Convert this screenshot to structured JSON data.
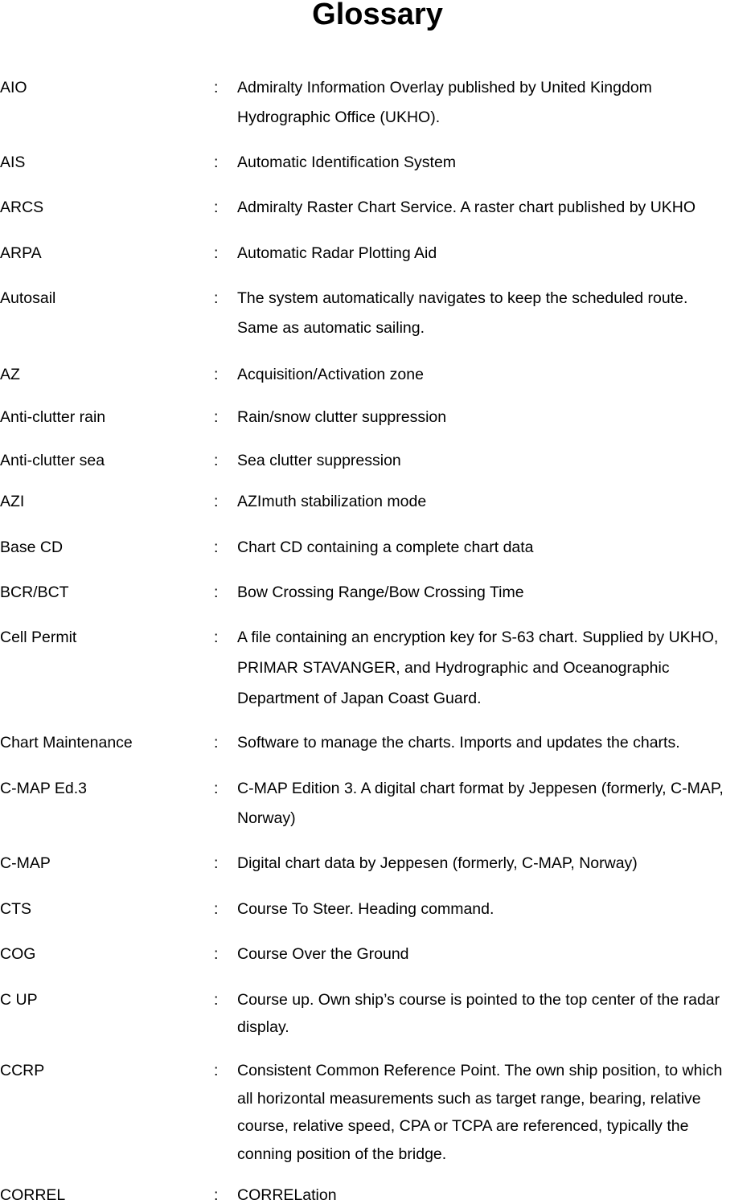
{
  "title": "Glossary",
  "separator": ":",
  "entries": [
    {
      "term": "AIO",
      "lines": [
        "Admiralty Information Overlay published by United Kingdom",
        "Hydrographic Office (UKHO)."
      ]
    },
    {
      "term": "AIS",
      "lines": [
        "Automatic Identification System"
      ]
    },
    {
      "term": "ARCS",
      "lines": [
        "Admiralty Raster Chart Service. A raster chart published by UKHO"
      ]
    },
    {
      "term": "ARPA",
      "lines": [
        "Automatic Radar Plotting Aid"
      ]
    },
    {
      "term": "Autosail",
      "lines": [
        "The system automatically navigates to keep the scheduled route.",
        "Same as automatic sailing."
      ]
    },
    {
      "term": "AZ",
      "lines": [
        "Acquisition/Activation zone"
      ]
    },
    {
      "term": "Anti-clutter rain",
      "lines": [
        "Rain/snow clutter suppression"
      ]
    },
    {
      "term": "Anti-clutter sea",
      "lines": [
        "Sea clutter suppression"
      ]
    },
    {
      "term": "AZI",
      "lines": [
        "AZImuth stabilization mode"
      ]
    },
    {
      "term": "Base CD",
      "lines": [
        "Chart CD containing a complete chart data"
      ]
    },
    {
      "term": "BCR/BCT",
      "lines": [
        "Bow Crossing Range/Bow Crossing Time"
      ]
    },
    {
      "term": "Cell Permit",
      "lines": [
        "A file containing an encryption key for S-63 chart. Supplied by UKHO,",
        "PRIMAR STAVANGER, and Hydrographic and Oceanographic",
        "Department of Japan Coast Guard."
      ]
    },
    {
      "term": "Chart Maintenance",
      "lines": [
        "Software to manage the charts. Imports and updates the charts."
      ]
    },
    {
      "term": "C-MAP Ed.3",
      "lines": [
        "C-MAP Edition 3. A digital chart format by Jeppesen (formerly, C-MAP,",
        "Norway)"
      ]
    },
    {
      "term": "C-MAP",
      "lines": [
        "Digital chart data by Jeppesen (formerly, C-MAP, Norway)"
      ]
    },
    {
      "term": "CTS",
      "lines": [
        "Course To Steer. Heading command."
      ]
    },
    {
      "term": "COG",
      "lines": [
        "Course Over the Ground"
      ]
    },
    {
      "term": "C UP",
      "lines": [
        "Course up. Own ship’s course is pointed to the top center of the radar",
        "display."
      ]
    },
    {
      "term": "CCRP",
      "lines": [
        "Consistent Common Reference Point. The own ship position, to which",
        "all horizontal measurements such as target range, bearing, relative",
        "course, relative speed, CPA or TCPA are referenced, typically the",
        "conning position of the bridge."
      ]
    },
    {
      "term": "CORREL",
      "lines": [
        "CORRELation"
      ]
    }
  ]
}
